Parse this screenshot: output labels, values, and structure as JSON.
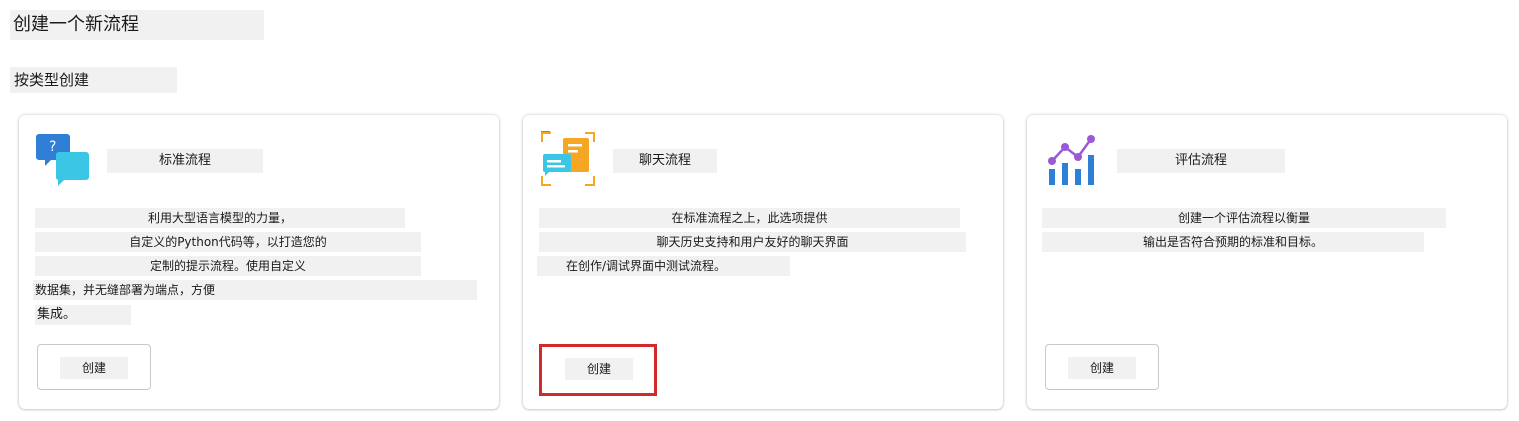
{
  "page": {
    "title": "创建一个新流程",
    "section_title": "按类型创建"
  },
  "cards": [
    {
      "title": "标准流程",
      "icon": "chat-question-icon",
      "description": [
        "利用大型语言模型的力量，",
        "自定义的Python代码等，以打造您的",
        "定制的提示流程。使用自定义",
        "数据集，并无缝部署为端点，方便",
        "集成。"
      ],
      "button": "创建"
    },
    {
      "title": "聊天流程",
      "icon": "chat-document-icon",
      "description": [
        "在标准流程之上，此选项提供",
        "聊天历史支持和用户友好的聊天界面",
        "在创作/调试界面中测试流程。"
      ],
      "button": "创建"
    },
    {
      "title": "评估流程",
      "icon": "chart-evaluation-icon",
      "description": [
        "创建一个评估流程以衡量",
        "输出是否符合预期的标准和目标。"
      ],
      "button": "创建"
    }
  ],
  "colors": {
    "highlight": "#d12a2a",
    "placeholder_bg": "#f1f1f1",
    "icon_blue": "#2f7fd6",
    "icon_cyan": "#3cc6e6",
    "icon_orange": "#f5a623",
    "icon_purple": "#9b59d6"
  }
}
